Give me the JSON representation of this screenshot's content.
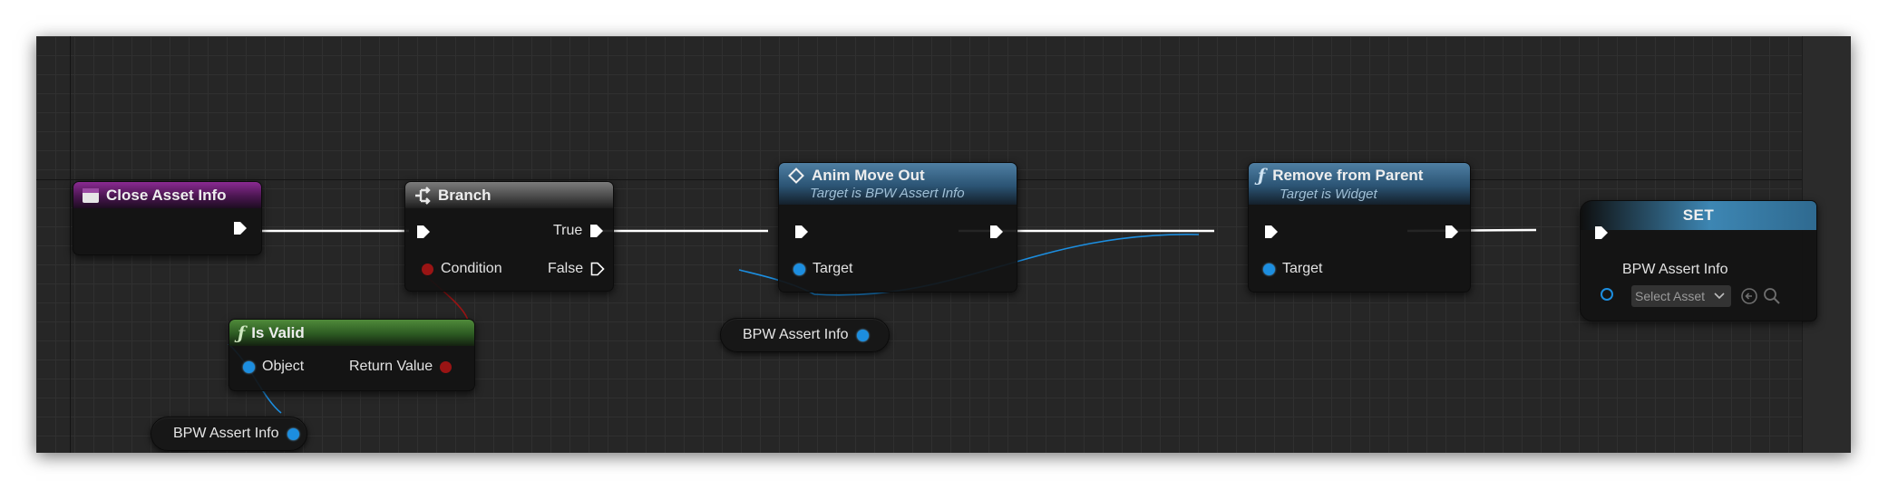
{
  "nodes": {
    "close_asset_info": {
      "title": "Close Asset Info"
    },
    "branch": {
      "title": "Branch",
      "pins": {
        "true": "True",
        "false": "False",
        "condition": "Condition"
      }
    },
    "is_valid": {
      "title": "Is Valid",
      "pins": {
        "object": "Object",
        "return_value": "Return Value"
      }
    },
    "anim_move_out": {
      "title": "Anim Move Out",
      "subtitle": "Target is BPW Assert Info",
      "pins": {
        "target": "Target"
      }
    },
    "remove_from_parent": {
      "title": "Remove from Parent",
      "subtitle": "Target is Widget",
      "pins": {
        "target": "Target"
      }
    },
    "set": {
      "title": "SET",
      "pins": {
        "variable": "BPW Assert Info"
      },
      "select_placeholder": "Select Asset"
    }
  },
  "variables": {
    "bpw_assert_info_a": "BPW Assert Info",
    "bpw_assert_info_b": "BPW Assert Info"
  },
  "colors": {
    "exec_wire": "#ffffff",
    "object_pin": "#1c8ee0",
    "bool_pin": "#9a1414",
    "grid_bg": "#262626"
  },
  "icons": {
    "event": "event-icon",
    "branch": "branch-icon",
    "function": "function-icon",
    "macro": "diamond-icon",
    "use_selected": "arrow-left-circle-icon",
    "browse": "magnifier-icon"
  }
}
